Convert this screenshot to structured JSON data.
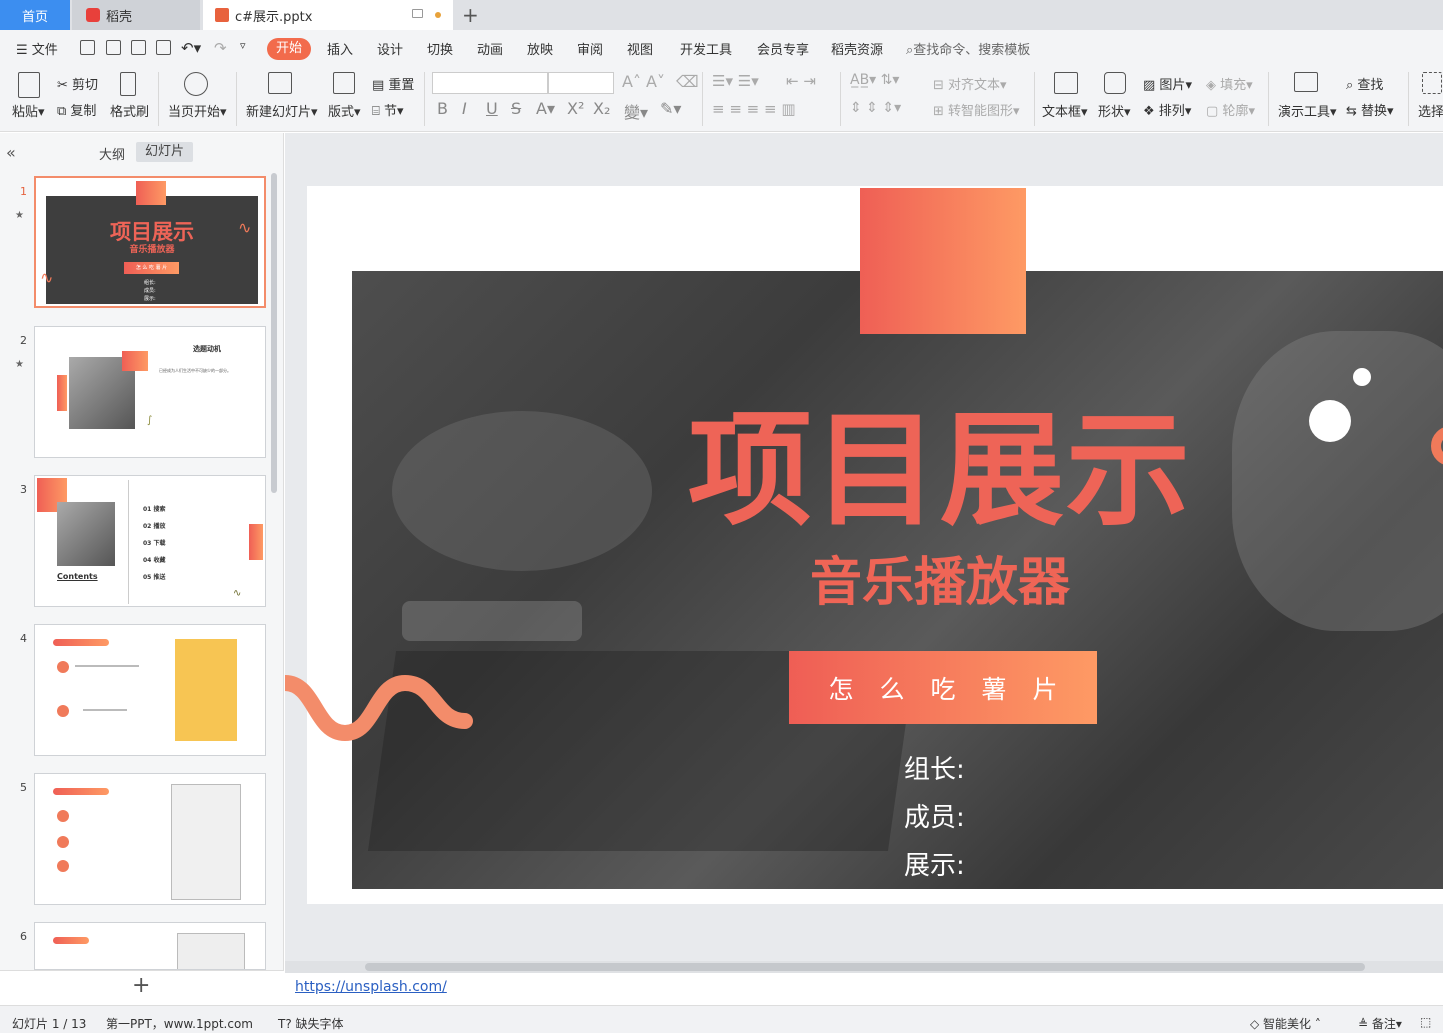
{
  "tabs": {
    "home": "首页",
    "daoke": "稻壳",
    "document": "c#展示.pptx"
  },
  "menu": {
    "file": "文件",
    "items": [
      "开始",
      "插入",
      "设计",
      "切换",
      "动画",
      "放映",
      "审阅",
      "视图",
      "开发工具",
      "会员专享",
      "稻壳资源"
    ],
    "search": "查找命令、搜索模板"
  },
  "ribbon": {
    "paste": "粘贴",
    "cut": "剪切",
    "copy": "复制",
    "format_painter": "格式刷",
    "from_current": "当页开始",
    "new_slide": "新建幻灯片",
    "layout": "版式",
    "reset": "重置",
    "section": "节",
    "align_text": "对齐文本",
    "smartart": "转智能图形",
    "textbox": "文本框",
    "shape": "形状",
    "picture": "图片",
    "arrange": "排列",
    "fill": "填充",
    "outline": "轮廓",
    "presenter_tools": "演示工具",
    "find": "查找",
    "replace": "替换",
    "select": "选择"
  },
  "left_panel": {
    "outline_tab": "大纲",
    "slides_tab": "幻灯片"
  },
  "thumbnails": {
    "s1": {
      "num": "1",
      "title": "项目展示",
      "subtitle": "音乐播放器",
      "bar": "怎 么 吃 薯 片",
      "lines": [
        "组长:",
        "成员:",
        "展示:"
      ]
    },
    "s2": {
      "num": "2",
      "title": "选题动机",
      "text": "已经成为人们生活中不可缺少的一部分。"
    },
    "s3": {
      "num": "3",
      "contents": "Contents",
      "items": [
        "01  搜索",
        "02  播放",
        "03  下载",
        "04  收藏",
        "05  推送"
      ]
    },
    "s4": {
      "num": "4"
    },
    "s5": {
      "num": "5"
    },
    "s6": {
      "num": "6"
    }
  },
  "slide": {
    "title": "项目展示",
    "subtitle": "音乐播放器",
    "namebar": "怎么吃薯片",
    "roles": [
      "组长:",
      "成员:",
      "展示:"
    ]
  },
  "link": "https://unsplash.com/",
  "status": {
    "slide_counter": "幻灯片 1 / 13",
    "theme": "第一PPT，www.1ppt.com",
    "missing_font": "缺失字体",
    "beautify": "智能美化",
    "notes": "备注"
  },
  "colors": {
    "accent": "#f26b4c",
    "slide_orange": "#ef6457",
    "gradient_start": "#ef5e55",
    "gradient_end": "#fe9a64"
  }
}
